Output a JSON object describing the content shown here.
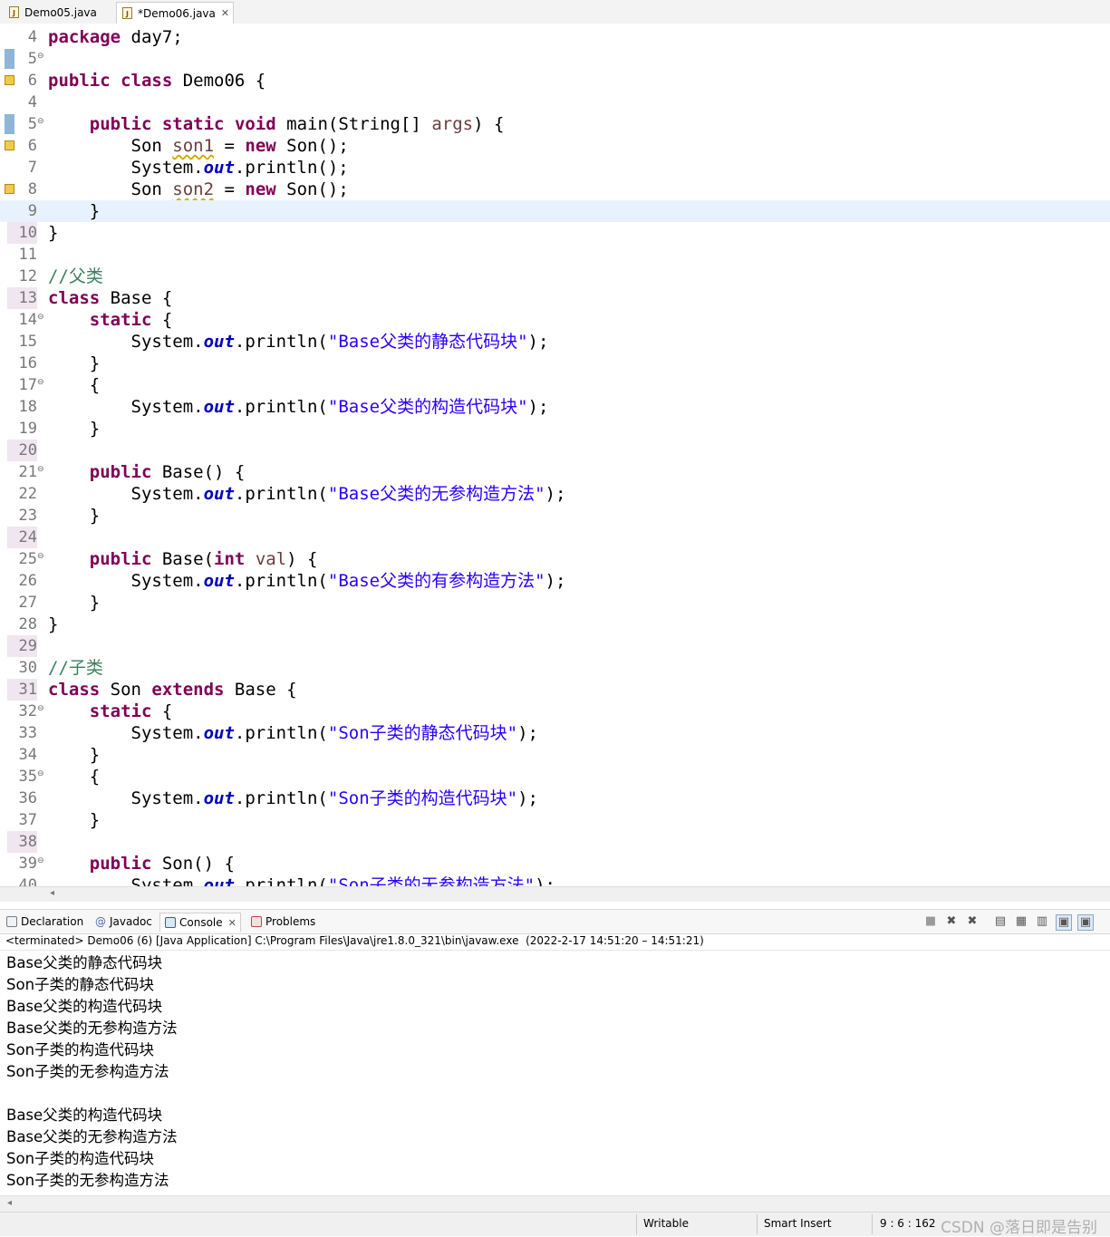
{
  "tabs": [
    {
      "label": "Demo05.java",
      "icon": "java-file-icon"
    },
    {
      "label": "*Demo06.java",
      "icon": "java-file-icon",
      "close": "✕"
    }
  ],
  "code_lines": [
    {
      "n": "4",
      "html": "<span class=\"k\">package</span> day7;"
    },
    {
      "n": "5",
      "fold": true,
      "html": ""
    },
    {
      "n": "6",
      "html": "<span class=\"k\">public</span> <span class=\"k\">class</span> Demo06 {"
    },
    {
      "n": "4",
      "html": ""
    },
    {
      "n": "5",
      "fold": true,
      "html": "    <span class=\"k\">public</span> <span class=\"k\">static</span> <span class=\"k\">void</span> main(String[] <span class=\"v\">args</span>) {"
    },
    {
      "n": "6",
      "html": "        Son <span class=\"v warn\">son1</span> = <span class=\"k\">new</span> Son();"
    },
    {
      "n": "7",
      "html": "        System.<span class=\"f\">out</span>.println();"
    },
    {
      "n": "8",
      "html": "        Son <span class=\"v warn\">son2</span> = <span class=\"k\">new</span> Son();"
    },
    {
      "n": "9",
      "cur": true,
      "html": "    }"
    },
    {
      "n": "10",
      "hl": true,
      "html": "}"
    },
    {
      "n": "11",
      "html": ""
    },
    {
      "n": "12",
      "html": "<span class=\"c\">//父类</span>"
    },
    {
      "n": "13",
      "hl": true,
      "html": "<span class=\"k\">class</span> Base {"
    },
    {
      "n": "14",
      "fold": true,
      "html": "    <span class=\"k\">static</span> {"
    },
    {
      "n": "15",
      "html": "        System.<span class=\"f\">out</span>.println(<span class=\"s\">\"Base父类的静态代码块\"</span>);"
    },
    {
      "n": "16",
      "html": "    }"
    },
    {
      "n": "17",
      "fold": true,
      "html": "    {"
    },
    {
      "n": "18",
      "html": "        System.<span class=\"f\">out</span>.println(<span class=\"s\">\"Base父类的构造代码块\"</span>);"
    },
    {
      "n": "19",
      "html": "    }"
    },
    {
      "n": "20",
      "hl": true,
      "html": ""
    },
    {
      "n": "21",
      "fold": true,
      "html": "    <span class=\"k\">public</span> Base() {"
    },
    {
      "n": "22",
      "html": "        System.<span class=\"f\">out</span>.println(<span class=\"s\">\"Base父类的无参构造方法\"</span>);"
    },
    {
      "n": "23",
      "html": "    }"
    },
    {
      "n": "24",
      "hl": true,
      "html": ""
    },
    {
      "n": "25",
      "fold": true,
      "html": "    <span class=\"k\">public</span> Base(<span class=\"k\">int</span> <span class=\"v\">val</span>) {"
    },
    {
      "n": "26",
      "html": "        System.<span class=\"f\">out</span>.println(<span class=\"s\">\"Base父类的有参构造方法\"</span>);"
    },
    {
      "n": "27",
      "html": "    }"
    },
    {
      "n": "28",
      "html": "}"
    },
    {
      "n": "29",
      "hl": true,
      "html": ""
    },
    {
      "n": "30",
      "html": "<span class=\"c\">//子类</span>"
    },
    {
      "n": "31",
      "hl": true,
      "html": "<span class=\"k\">class</span> Son <span class=\"k\">extends</span> Base {"
    },
    {
      "n": "32",
      "fold": true,
      "html": "    <span class=\"k\">static</span> {"
    },
    {
      "n": "33",
      "html": "        System.<span class=\"f\">out</span>.println(<span class=\"s\">\"Son子类的静态代码块\"</span>);"
    },
    {
      "n": "34",
      "html": "    }"
    },
    {
      "n": "35",
      "fold": true,
      "html": "    {"
    },
    {
      "n": "36",
      "html": "        System.<span class=\"f\">out</span>.println(<span class=\"s\">\"Son子类的构造代码块\"</span>);"
    },
    {
      "n": "37",
      "html": "    }"
    },
    {
      "n": "38",
      "hl": true,
      "html": ""
    },
    {
      "n": "39",
      "fold": true,
      "html": "    <span class=\"k\">public</span> Son() {"
    },
    {
      "n": "40",
      "html": "        System.<span class=\"f\">out</span>.println(<span class=\"s\">\"Son子类的无参构造方法\"</span>);"
    }
  ],
  "panel_tabs": [
    {
      "label": "Declaration",
      "icon": "declaration-icon"
    },
    {
      "label": "Javadoc",
      "icon": "javadoc-icon"
    },
    {
      "label": "Console",
      "icon": "console-icon",
      "active": true,
      "close": "✕"
    },
    {
      "label": "Problems",
      "icon": "problems-icon"
    }
  ],
  "console_status": "<terminated> Demo06 (6) [Java Application] C:\\Program Files\\Java\\jre1.8.0_321\\bin\\javaw.exe  (2022-2-17 14:51:20 – 14:51:21)",
  "console_output": [
    "Base父类的静态代码块",
    "Son子类的静态代码块",
    "Base父类的构造代码块",
    "Base父类的无参构造方法",
    "Son子类的构造代码块",
    "Son子类的无参构造方法",
    "",
    "Base父类的构造代码块",
    "Base父类的无参构造方法",
    "Son子类的构造代码块",
    "Son子类的无参构造方法"
  ],
  "status_bar": {
    "writable": "Writable",
    "insert_mode": "Smart Insert",
    "position": "9 : 6 : 162",
    "watermark": "CSDN @落日即是告别"
  }
}
